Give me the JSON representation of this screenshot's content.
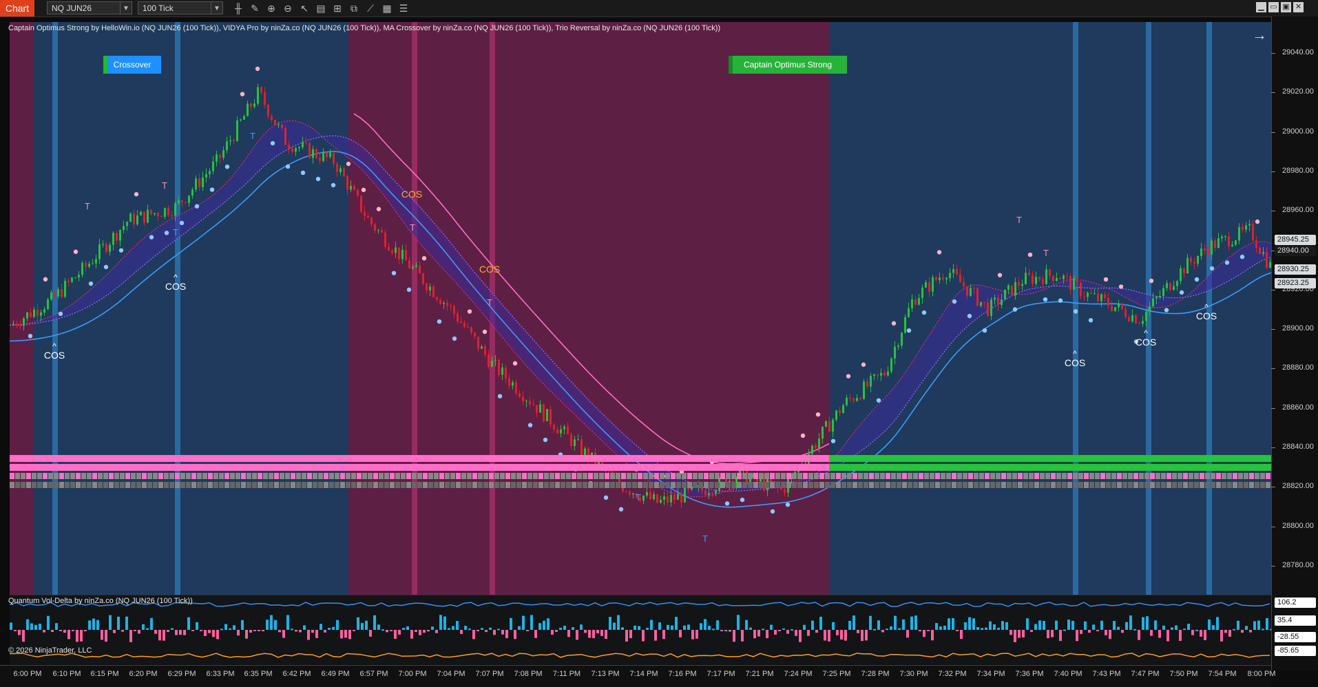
{
  "toolbar": {
    "chart_tab": "Chart",
    "instrument": "NQ JUN26",
    "interval": "100 Tick",
    "tools": [
      {
        "name": "bars-type-icon",
        "glyph": "╫"
      },
      {
        "name": "draw-pencil-icon",
        "glyph": "✎"
      },
      {
        "name": "zoom-in-icon",
        "glyph": "⊕"
      },
      {
        "name": "zoom-out-icon",
        "glyph": "⊖"
      },
      {
        "name": "pointer-icon",
        "glyph": "↖"
      },
      {
        "name": "data-box-icon",
        "glyph": "▤"
      },
      {
        "name": "templates-icon",
        "glyph": "⊞"
      },
      {
        "name": "split-icon",
        "glyph": "⧉"
      },
      {
        "name": "strategies-icon",
        "glyph": "⟋"
      },
      {
        "name": "calculator-icon",
        "glyph": "▦"
      },
      {
        "name": "list-icon",
        "glyph": "☰"
      }
    ],
    "window_buttons": [
      "▁",
      "▭",
      "▣",
      "✕"
    ]
  },
  "legend": "Captain Optimus Strong by HelloWin.io (NQ JUN26 (100 Tick)), VIDYA Pro by ninZa.co (NQ JUN26 (100 Tick)), MA Crossover by ninZa.co (NQ JUN26 (100 Tick)), Trio Reversal by ninZa.co (NQ JUN26 (100 Tick))",
  "badges": {
    "crossover": "Crossover",
    "captain": "Captain Optimus Strong"
  },
  "subpanel": {
    "title": "Quantum Vol-Delta by ninZa.co (NQ JUN26 (100 Tick))",
    "copyright": "© 2026 NinjaTrader, LLC"
  },
  "y_axis": {
    "ticks": [
      "29040.00",
      "29020.00",
      "29000.00",
      "28980.00",
      "28960.00",
      "28940.00",
      "28920.00",
      "28900.00",
      "28880.00",
      "28860.00",
      "28840.00",
      "28820.00",
      "28800.00",
      "28780.00"
    ],
    "price_labels": [
      {
        "text": "28945.25",
        "bg": "#d8dce0",
        "fg": "#111"
      },
      {
        "text": "28940.00",
        "bg": "#1a1a1a",
        "fg": "#ddd"
      },
      {
        "text": "28930.25",
        "bg": "#d8dce0",
        "fg": "#111"
      },
      {
        "text": "28923.25",
        "bg": "#d8dce0",
        "fg": "#111"
      }
    ],
    "sub_labels": [
      {
        "text": "106.2",
        "bg": "#ffffff",
        "fg": "#111"
      },
      {
        "text": "35.4",
        "bg": "#ffffff",
        "fg": "#111"
      },
      {
        "text": "-28.55",
        "bg": "#ffffff",
        "fg": "#111"
      },
      {
        "text": "-85.65",
        "bg": "#ffffff",
        "fg": "#111"
      }
    ]
  },
  "x_axis": {
    "ticks": [
      "6:00 PM",
      "6:10 PM",
      "6:15 PM",
      "6:20 PM",
      "6:29 PM",
      "6:33 PM",
      "6:35 PM",
      "6:42 PM",
      "6:49 PM",
      "6:57 PM",
      "7:00 PM",
      "7:04 PM",
      "7:07 PM",
      "7:08 PM",
      "7:11 PM",
      "7:13 PM",
      "7:14 PM",
      "7:16 PM",
      "7:17 PM",
      "7:21 PM",
      "7:24 PM",
      "7:25 PM",
      "7:28 PM",
      "7:30 PM",
      "7:32 PM",
      "7:34 PM",
      "7:36 PM",
      "7:40 PM",
      "7:43 PM",
      "7:47 PM",
      "7:50 PM",
      "7:54 PM",
      "8:00 PM"
    ]
  },
  "signals": {
    "cos": "COS",
    "t": "T"
  },
  "colors": {
    "bull": "#27c33a",
    "bear": "#e0202c",
    "blue_bg": "#1f3a5c",
    "pink_bg": "#5e1f45",
    "accent_blue": "#1e90ff",
    "vidya_pink": "#ff6ec7"
  }
}
